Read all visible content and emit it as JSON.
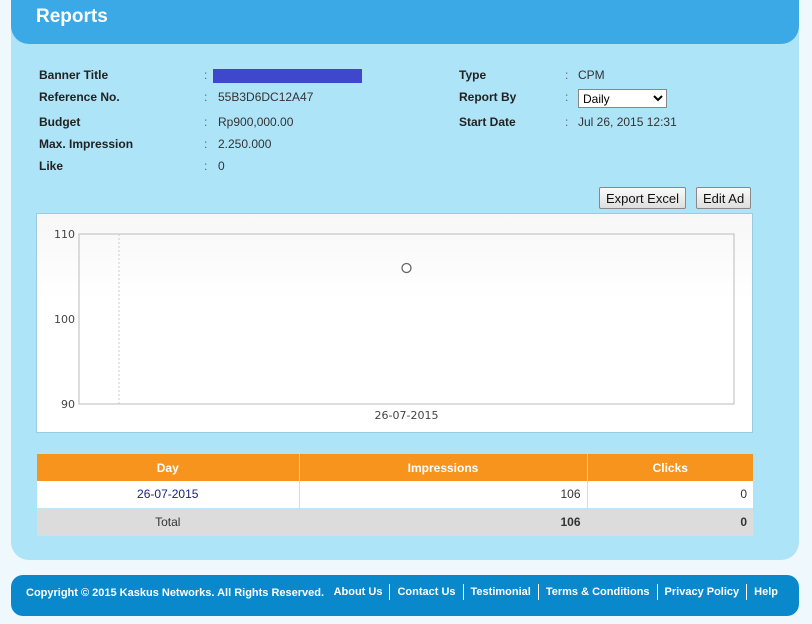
{
  "header": {
    "title": "Reports"
  },
  "info": {
    "banner_title_label": "Banner Title",
    "reference_label": "Reference No.",
    "reference": "55B3D6DC12A47",
    "budget_label": "Budget",
    "budget": "Rp900,000.00",
    "max_impression_label": "Max. Impression",
    "max_impression": "2.250.000",
    "like_label": "Like",
    "like": "0",
    "type_label": "Type",
    "type": "CPM",
    "report_by_label": "Report By",
    "report_by": "Daily",
    "start_date_label": "Start Date",
    "start_date": "Jul 26, 2015 12:31",
    "colon": ":"
  },
  "buttons": {
    "export": "Export Excel",
    "edit": "Edit Ad"
  },
  "chart_data": {
    "type": "scatter",
    "x": [
      "26-07-2015"
    ],
    "y": [
      106
    ],
    "ylim": [
      90,
      110
    ],
    "yticks": [
      "90",
      "100",
      "110"
    ],
    "xticks": [
      "26-07-2015"
    ],
    "grid": false,
    "marker": "hollow-circle"
  },
  "table": {
    "headers": [
      "Day",
      "Impressions",
      "Clicks"
    ],
    "rows": [
      [
        "26-07-2015",
        "106",
        "0"
      ]
    ],
    "total": [
      "Total",
      "106",
      "0"
    ]
  },
  "footer": {
    "copyright": "Copyright © 2015 Kaskus Networks. All Rights Reserved.",
    "links": [
      "About Us",
      "Contact Us",
      "Testimonial",
      "Terms & Conditions",
      "Privacy Policy",
      "Help"
    ]
  }
}
